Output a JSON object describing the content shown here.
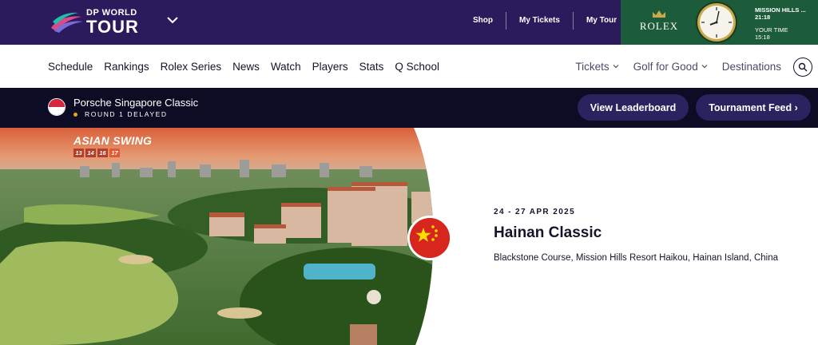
{
  "header": {
    "logo_top": "DP WORLD",
    "logo_bottom": "TOUR",
    "links": [
      {
        "label": "Shop"
      },
      {
        "label": "My Tickets"
      },
      {
        "label": "My Tour"
      }
    ],
    "rolex": {
      "brand": "ROLEX",
      "location": "MISSION HILLS ...",
      "local_time": "21:18",
      "your_time_label": "YOUR TIME",
      "your_time": "15:18"
    }
  },
  "nav": {
    "left": [
      "Schedule",
      "Rankings",
      "Rolex Series",
      "News",
      "Watch",
      "Players",
      "Stats",
      "Q School"
    ],
    "right": [
      {
        "label": "Tickets",
        "dropdown": true
      },
      {
        "label": "Golf for Good",
        "dropdown": true
      },
      {
        "label": "Destinations",
        "dropdown": false
      }
    ],
    "search_icon": "search-icon"
  },
  "live": {
    "tournament": "Porsche Singapore Classic",
    "status": "ROUND 1 DELAYED",
    "status_color": "#f2a40a",
    "buttons": {
      "leaderboard": "View Leaderboard",
      "feed": "Tournament Feed ›"
    }
  },
  "hero": {
    "swing_title": "ASIAN SWING",
    "swing_weeks": [
      "13",
      "14",
      "16",
      "17"
    ],
    "event": {
      "dates": "24 - 27 APR 2025",
      "title": "Hainan Classic",
      "venue": "Blackstone Course, Mission Hills Resort Haikou, Hainan Island, China"
    }
  },
  "colors": {
    "topbar": "#2b1b5c",
    "rolex_green": "#1d5c3b",
    "livebar": "#0c0c24",
    "pill": "#2a2360"
  }
}
